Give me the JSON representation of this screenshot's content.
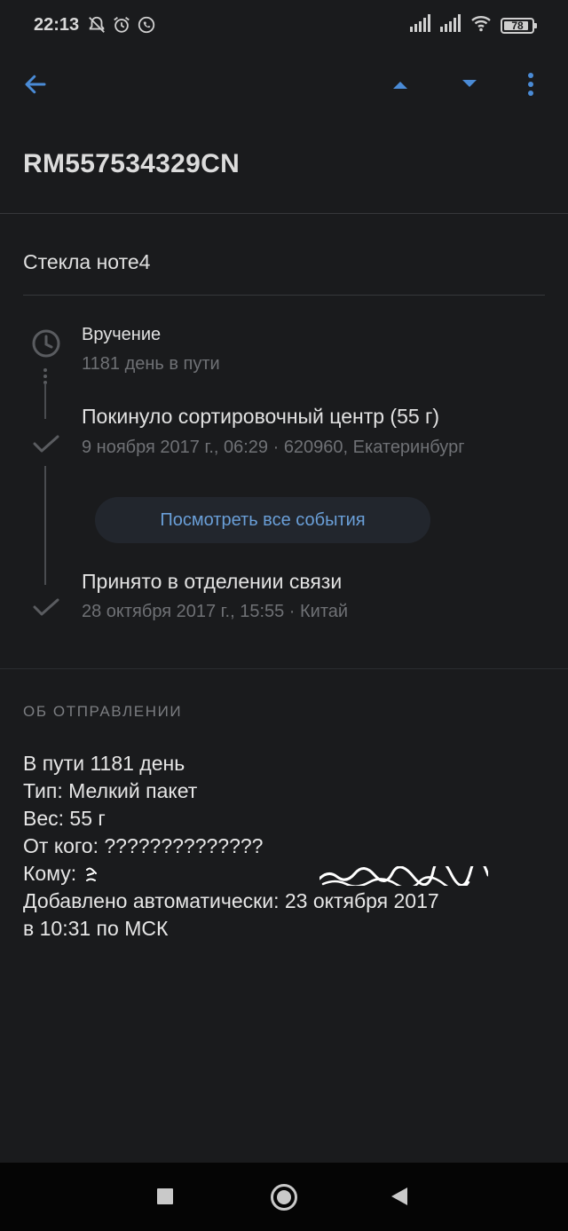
{
  "status_bar": {
    "time": "22:13",
    "icons_left": [
      "notifications-muted-icon",
      "alarm-icon",
      "whatsapp-icon"
    ],
    "icons_right": [
      "signal-icon",
      "signal-icon",
      "wifi-icon"
    ],
    "battery_level": "78"
  },
  "toolbar": {
    "icons": [
      "arrow-back-icon",
      "chevron-up-icon",
      "chevron-down-icon",
      "more-vert-icon"
    ],
    "accent_color": "#4a8bd6"
  },
  "parcel": {
    "track_number": "RM557534329CN",
    "name": "Стекла ноте4"
  },
  "events": [
    {
      "title": "Вручение",
      "subtitle": "1181 день в пути",
      "icon": "clock-icon"
    },
    {
      "title": "Покинуло сортировочный центр (55 г)",
      "subtitle": "9 ноября 2017 г., 06:29 · 620960, Екатеринбург",
      "icon": "check-icon"
    },
    {
      "title": "Принято в отделении связи",
      "subtitle": "28 октября 2017 г., 15:55 · Китай",
      "icon": "check-icon"
    }
  ],
  "all_events_button": "Посмотреть все события",
  "about": {
    "header": "ОБ ОТПРАВЛЕНИИ",
    "lines": {
      "in_transit": "В пути 1181 день",
      "type": "Тип: Мелкий пакет",
      "weight": "Вес: 55 г",
      "from": "От кого: ??????????????",
      "to_label": "Кому:",
      "added": "Добавлено автоматически: 23 октября 2017",
      "added_time": "в 10:31 по МСК"
    }
  },
  "nav_bar": {
    "icons": [
      "recents-square-icon",
      "home-circle-icon",
      "back-triangle-icon"
    ]
  }
}
